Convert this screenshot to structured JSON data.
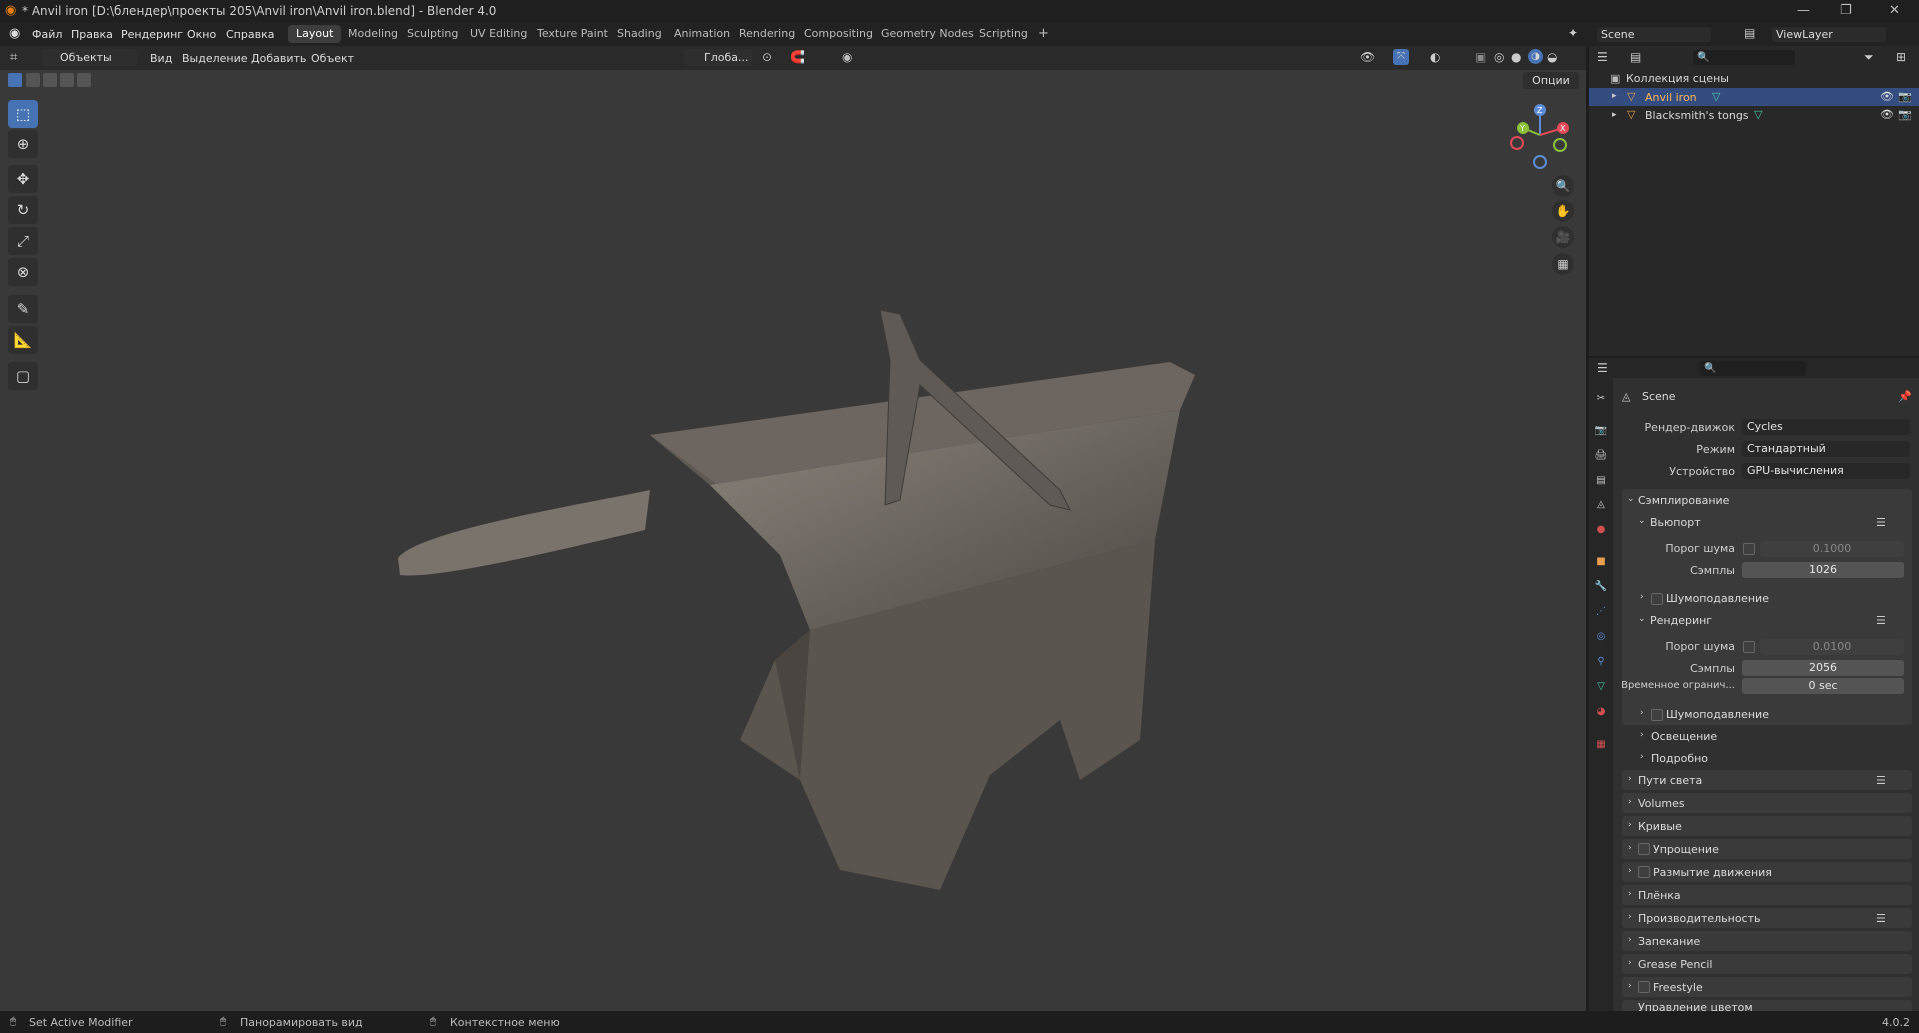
{
  "window": {
    "title": "* Anvil iron [D:\\блендер\\проекты 205\\Anvil iron\\Anvil iron.blend] - Blender 4.0"
  },
  "menu": [
    "Файл",
    "Правка",
    "Рендеринг",
    "Окно",
    "Справка"
  ],
  "workspaces": [
    "Layout",
    "Modeling",
    "Sculpting",
    "UV Editing",
    "Texture Paint",
    "Shading",
    "Animation",
    "Rendering",
    "Compositing",
    "Geometry Nodes",
    "Scripting"
  ],
  "active_workspace": "Layout",
  "scene": {
    "name": "Scene",
    "view_layer": "ViewLayer"
  },
  "viewport_header": {
    "mode": "Объекты",
    "view": "Вид",
    "select": "Выделение",
    "add": "Добавить",
    "object": "Объект",
    "orientation": "Глоба...",
    "options": "Опции"
  },
  "gizmo": {
    "x": "X",
    "y": "Y",
    "z": "Z"
  },
  "outliner": {
    "collection": "Коллекция сцены",
    "items": [
      {
        "name": "Anvil iron",
        "selected": true
      },
      {
        "name": "Blacksmith's tongs",
        "selected": false
      }
    ]
  },
  "properties": {
    "context": "Scene",
    "engine_label": "Рендер-движок",
    "engine": "Cycles",
    "mode_label": "Режим",
    "mode": "Стандартный",
    "device_label": "Устройство",
    "device": "GPU-вычисления",
    "sampling": "Сэмплирование",
    "viewport": "Вьюпорт",
    "noise_threshold_label": "Порог шума",
    "viewport_threshold": "0.1000",
    "samples_label": "Сэмплы",
    "viewport_samples": "1026",
    "denoise": "Шумоподавление",
    "render": "Рендеринг",
    "render_threshold": "0.0100",
    "render_samples": "2056",
    "time_limit_label": "Временное огранич...",
    "time_limit": "0 sec",
    "lights": "Освещение",
    "advanced": "Подробно",
    "sections": [
      "Пути света",
      "Volumes",
      "Кривые",
      "Упрощение",
      "Размытие движения",
      "Плёнка",
      "Производительность",
      "Запекание",
      "Grease Pencil",
      "Freestyle",
      "Управление цветом"
    ]
  },
  "statusbar": {
    "left": "Set Active Modifier",
    "middle": "Панорамировать вид",
    "right": "Контекстное меню",
    "version": "4.0.2"
  }
}
